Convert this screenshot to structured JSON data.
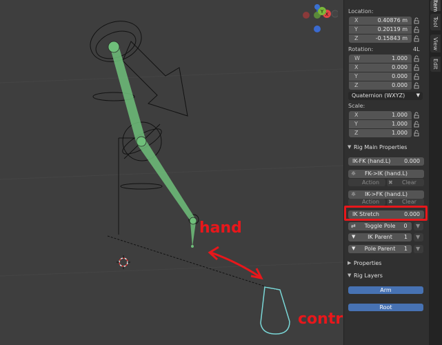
{
  "annotations": {
    "hand": "hand",
    "control": "control"
  },
  "gizmo": {
    "x": "X",
    "y": "Y",
    "z": "Z"
  },
  "sidebar_tabs": [
    "Item",
    "Tool",
    "View",
    "Edit"
  ],
  "transform": {
    "location_label": "Location:",
    "location": [
      {
        "axis": "X",
        "value": "0.40876 m"
      },
      {
        "axis": "Y",
        "value": "0.20119 m"
      },
      {
        "axis": "Z",
        "value": "-0.15843 m"
      }
    ],
    "rotation_label": "Rotation:",
    "rotation_mode_short": "4L",
    "rotation": [
      {
        "axis": "W",
        "value": "1.000"
      },
      {
        "axis": "X",
        "value": "0.000"
      },
      {
        "axis": "Y",
        "value": "0.000"
      },
      {
        "axis": "Z",
        "value": "0.000"
      }
    ],
    "rotation_mode": "Quaternion (WXYZ)",
    "scale_label": "Scale:",
    "scale": [
      {
        "axis": "X",
        "value": "1.000"
      },
      {
        "axis": "Y",
        "value": "1.000"
      },
      {
        "axis": "Z",
        "value": "1.000"
      }
    ]
  },
  "rig_main": {
    "title": "Rig Main Properties",
    "ikfk_label": "IK-FK (hand.L)",
    "ikfk_value": "0.000",
    "fk_ik_label": "FK->IK (hand.L)",
    "ik_fk_label": "IK->FK (hand.L)",
    "action_label": "Action",
    "clear_label": "Clear",
    "ik_stretch_label": "IK Stretch",
    "ik_stretch_value": "0.000",
    "toggle_pole_label": "Toggle Pole",
    "toggle_pole_value": "0",
    "ik_parent_label": "IK Parent",
    "ik_parent_value": "1",
    "pole_parent_label": "Pole Parent",
    "pole_parent_value": "1"
  },
  "properties_title": "Properties",
  "rig_layers": {
    "title": "Rig Layers",
    "arm": "Arm",
    "root": "Root"
  },
  "colors": {
    "accent": "#4772b3",
    "annotation": "#e8171b",
    "bone_green": "#6fbf7a"
  }
}
